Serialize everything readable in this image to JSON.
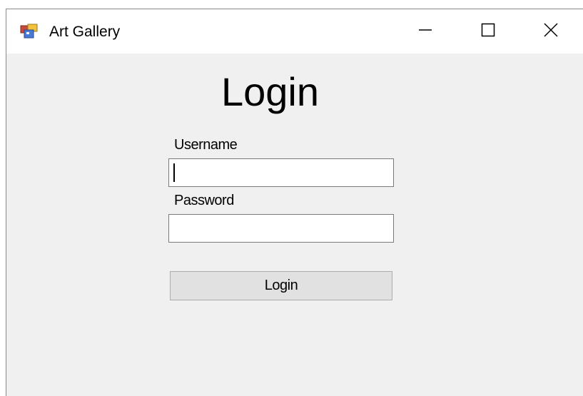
{
  "window": {
    "title": "Art Gallery",
    "icon": "app-window-icon"
  },
  "titlebar_buttons": {
    "minimize_icon": "minimize-icon",
    "maximize_icon": "maximize-icon",
    "close_icon": "close-icon"
  },
  "form": {
    "heading": "Login",
    "username_label": "Username",
    "username_value": "",
    "password_label": "Password",
    "password_value": "",
    "submit_label": "Login"
  },
  "colors": {
    "window_background": "#f0f0f0",
    "titlebar_background": "#ffffff",
    "button_background": "#e1e1e1",
    "input_border": "#7a7a7a"
  }
}
